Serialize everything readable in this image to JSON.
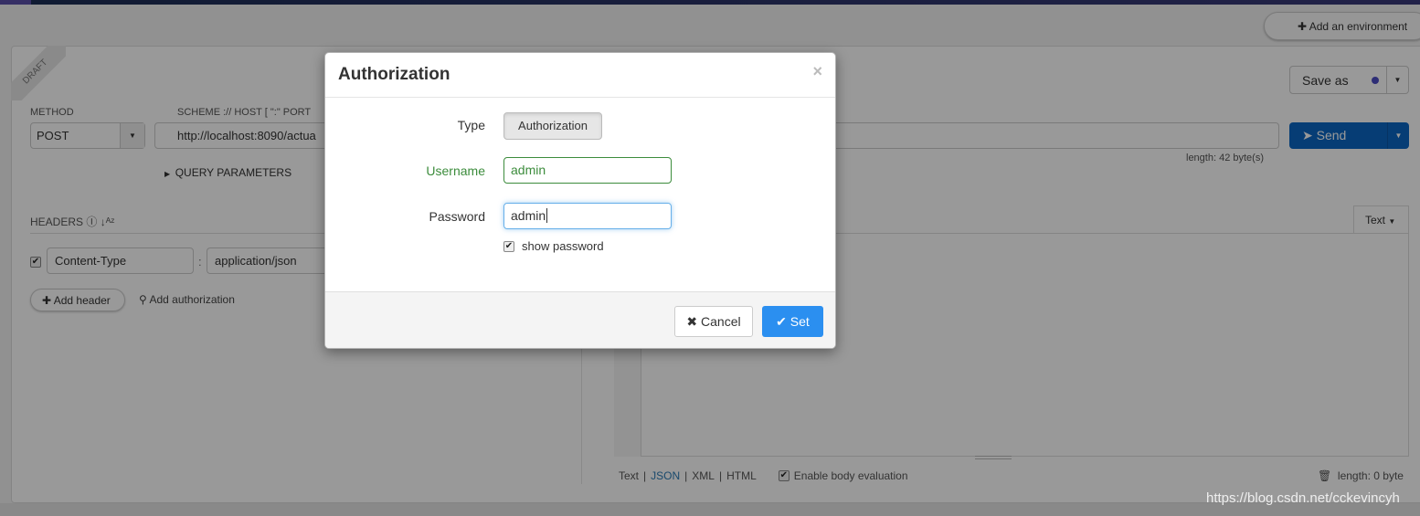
{
  "topbar": {
    "add_environment": "Add an environment"
  },
  "request": {
    "draft_badge": "DRAFT",
    "method_label": "METHOD",
    "method_value": "POST",
    "url_label": "SCHEME :// HOST [ \":\" PORT",
    "url_value": "http://localhost:8090/actua",
    "query_parameters": "QUERY PARAMETERS",
    "url_length": "length: 42 byte(s)",
    "save_as": "Save as",
    "send": "Send"
  },
  "headers": {
    "label": "HEADERS",
    "items": [
      {
        "enabled": true,
        "name": "Content-Type",
        "value": "application/json"
      }
    ],
    "add_header": "Add header",
    "add_authorization": "Add authorization"
  },
  "body": {
    "format_dropdown": "Text",
    "formats": [
      "Text",
      "JSON",
      "XML",
      "HTML"
    ],
    "selected_format": "JSON",
    "enable_body_evaluation": "Enable body evaluation",
    "length": "length: 0 byte"
  },
  "modal": {
    "title": "Authorization",
    "type_label": "Type",
    "type_value": "Authorization",
    "username_label": "Username",
    "username_value": "admin",
    "password_label": "Password",
    "password_value": "admin",
    "show_password": "show password",
    "show_password_checked": true,
    "cancel": "Cancel",
    "set": "Set"
  },
  "watermark": "https://blog.csdn.net/cckevincyh",
  "colors": {
    "send": "#0b66c3",
    "set": "#2b8ff0",
    "valid": "#3c8c3c"
  }
}
